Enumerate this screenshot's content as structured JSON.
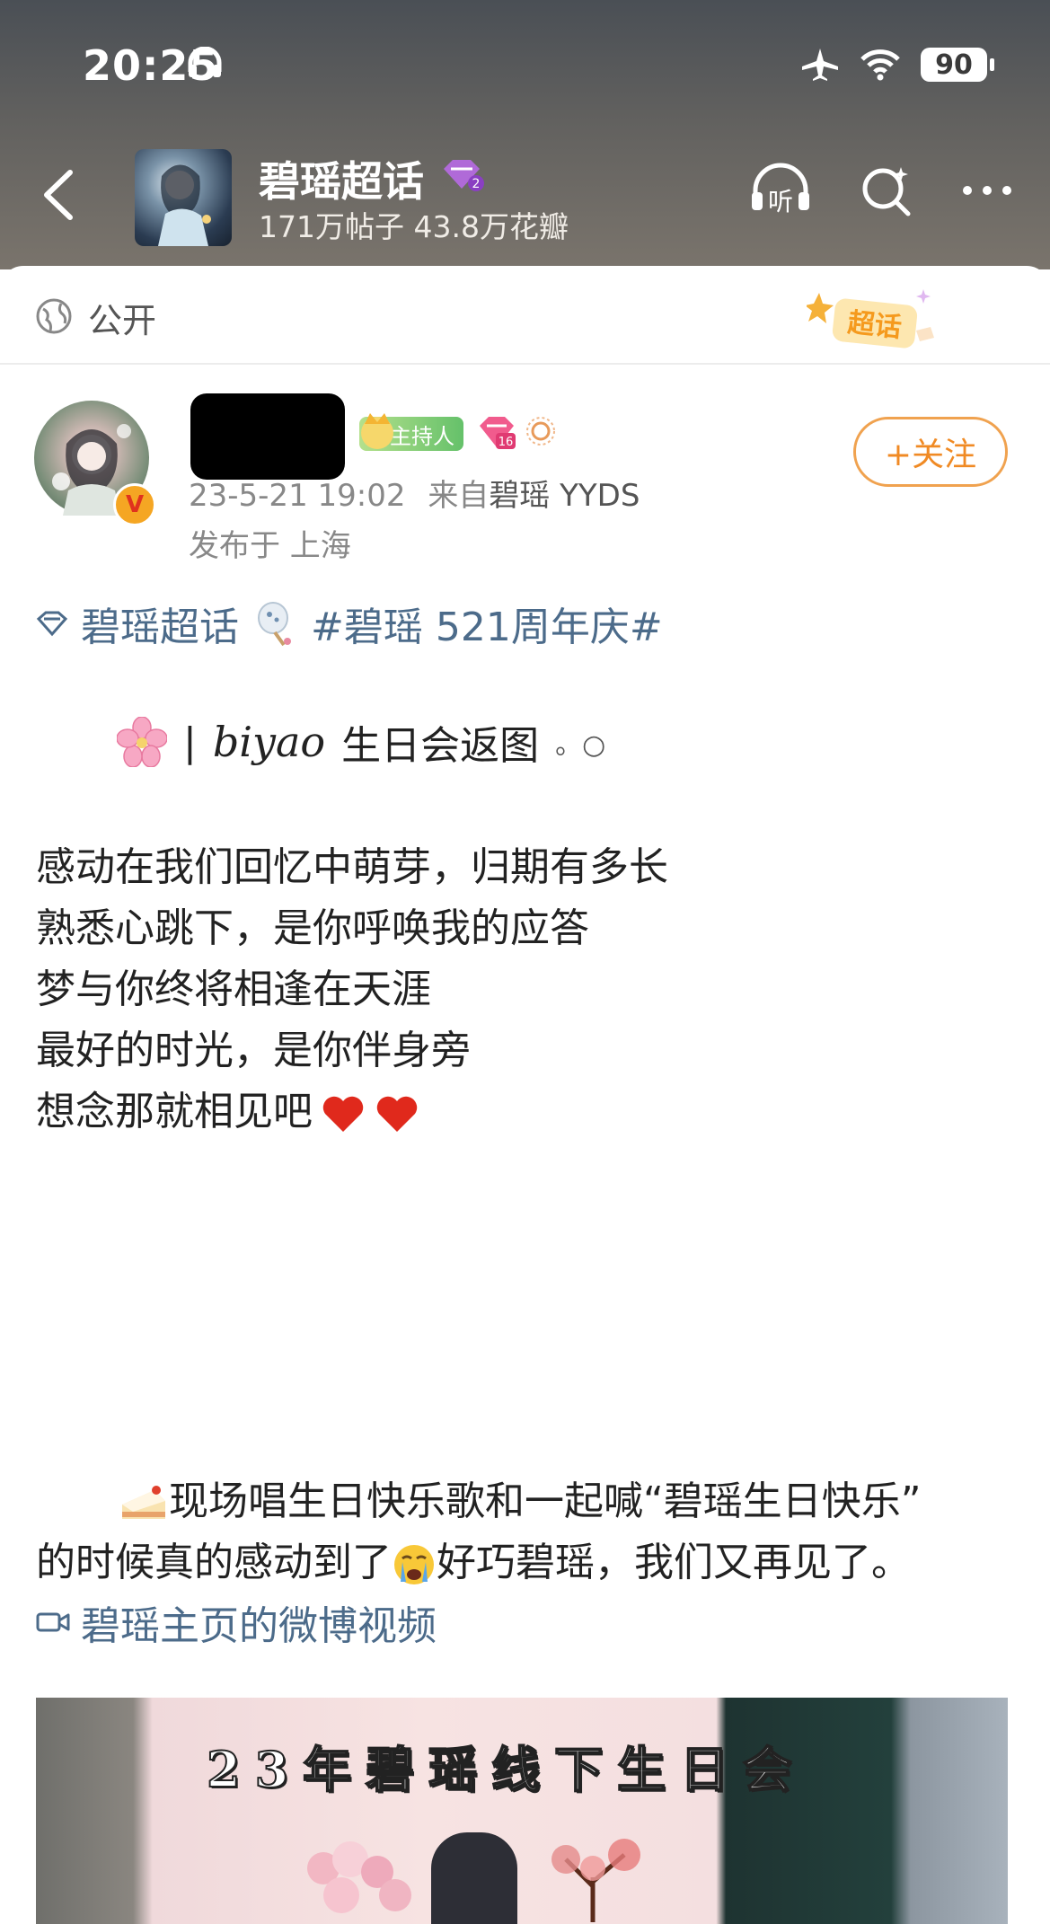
{
  "status_bar": {
    "time": "20:25",
    "battery": "90",
    "icons": [
      "headphones-icon",
      "airplane-icon",
      "wifi-icon",
      "battery-icon"
    ]
  },
  "header": {
    "title": "碧瑶超话",
    "stats": "171万帖子 43.8万花瓣",
    "level_badge": "2",
    "icons": [
      "back-icon",
      "listen-icon",
      "search-icon",
      "more-icon"
    ],
    "listen_label": "听"
  },
  "visibility": {
    "label": "公开",
    "badge_text": "超话"
  },
  "post": {
    "host_badge": "主持人",
    "level": "16",
    "verified_mark": "V",
    "timestamp": "23-5-21 19:02",
    "source_prefix": "来自",
    "source": "碧瑶 YYDS",
    "location": "发布于 上海",
    "follow_label": "+关注",
    "topic_tag": "碧瑶超话",
    "hashtag": "#碧瑶 521周年庆#",
    "subtitle_bar": "|",
    "subtitle_script": "biyao",
    "subtitle_text": "生日会返图",
    "subtitle_dots": "。○",
    "poem": [
      "感动在我们回忆中萌芽，归期有多长",
      "熟悉心跳下，是你呼唤我的应答",
      "梦与你终将相逢在天涯",
      "最好的时光，是你伴身旁",
      "想念那就相见吧"
    ],
    "paragraph_line1": "现场唱生日快乐歌和一起喊“碧瑶生日快乐”",
    "paragraph_line2_a": "的时候真的感动到了",
    "paragraph_line2_b": "好巧碧瑶，我们又再见了。",
    "video_link": "碧瑶主页的微博视频",
    "video_overlay_title": "23年碧瑶线下生日会"
  },
  "colors": {
    "link": "#4c6b8a",
    "follow": "#f08a24",
    "header_bg": "#5a5b5c"
  }
}
